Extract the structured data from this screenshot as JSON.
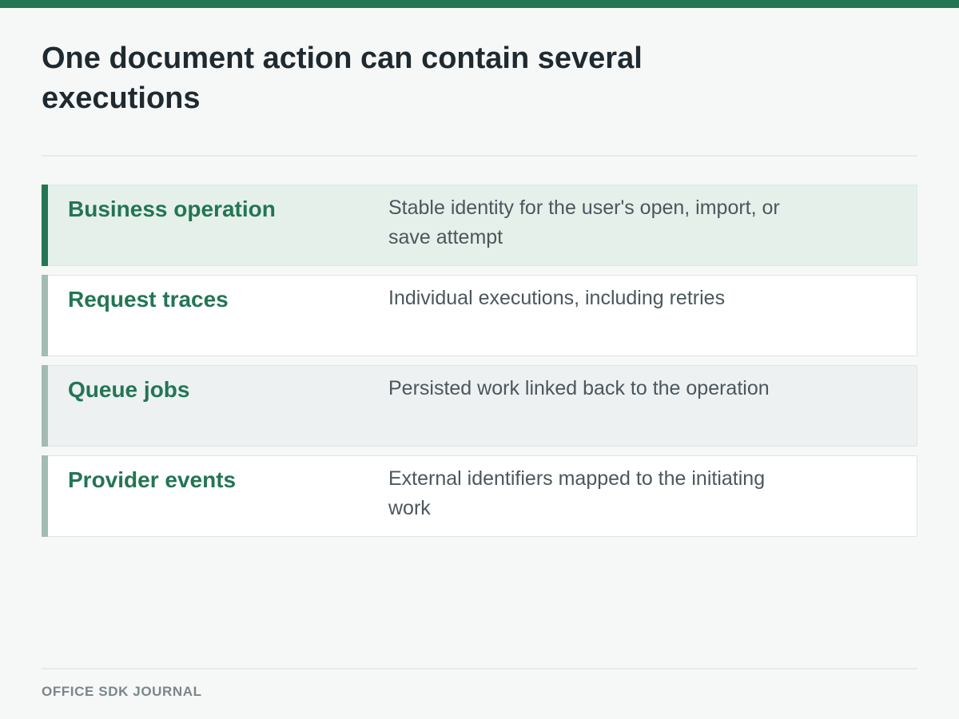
{
  "top_bar_color": "#237554",
  "accent_color": "#237554",
  "title": "One document action can contain several executions",
  "rows": [
    {
      "label": "Business operation",
      "description": "Stable identity for the user's open, import, or save attempt",
      "highlighted": true
    },
    {
      "label": "Request traces",
      "description": "Individual executions, including retries",
      "highlighted": false
    },
    {
      "label": "Queue jobs",
      "description": "Persisted work linked back to the operation",
      "highlighted": false
    },
    {
      "label": "Provider events",
      "description": "External identifiers mapped to the initiating work",
      "highlighted": false
    }
  ],
  "footer": "OFFICE SDK JOURNAL"
}
